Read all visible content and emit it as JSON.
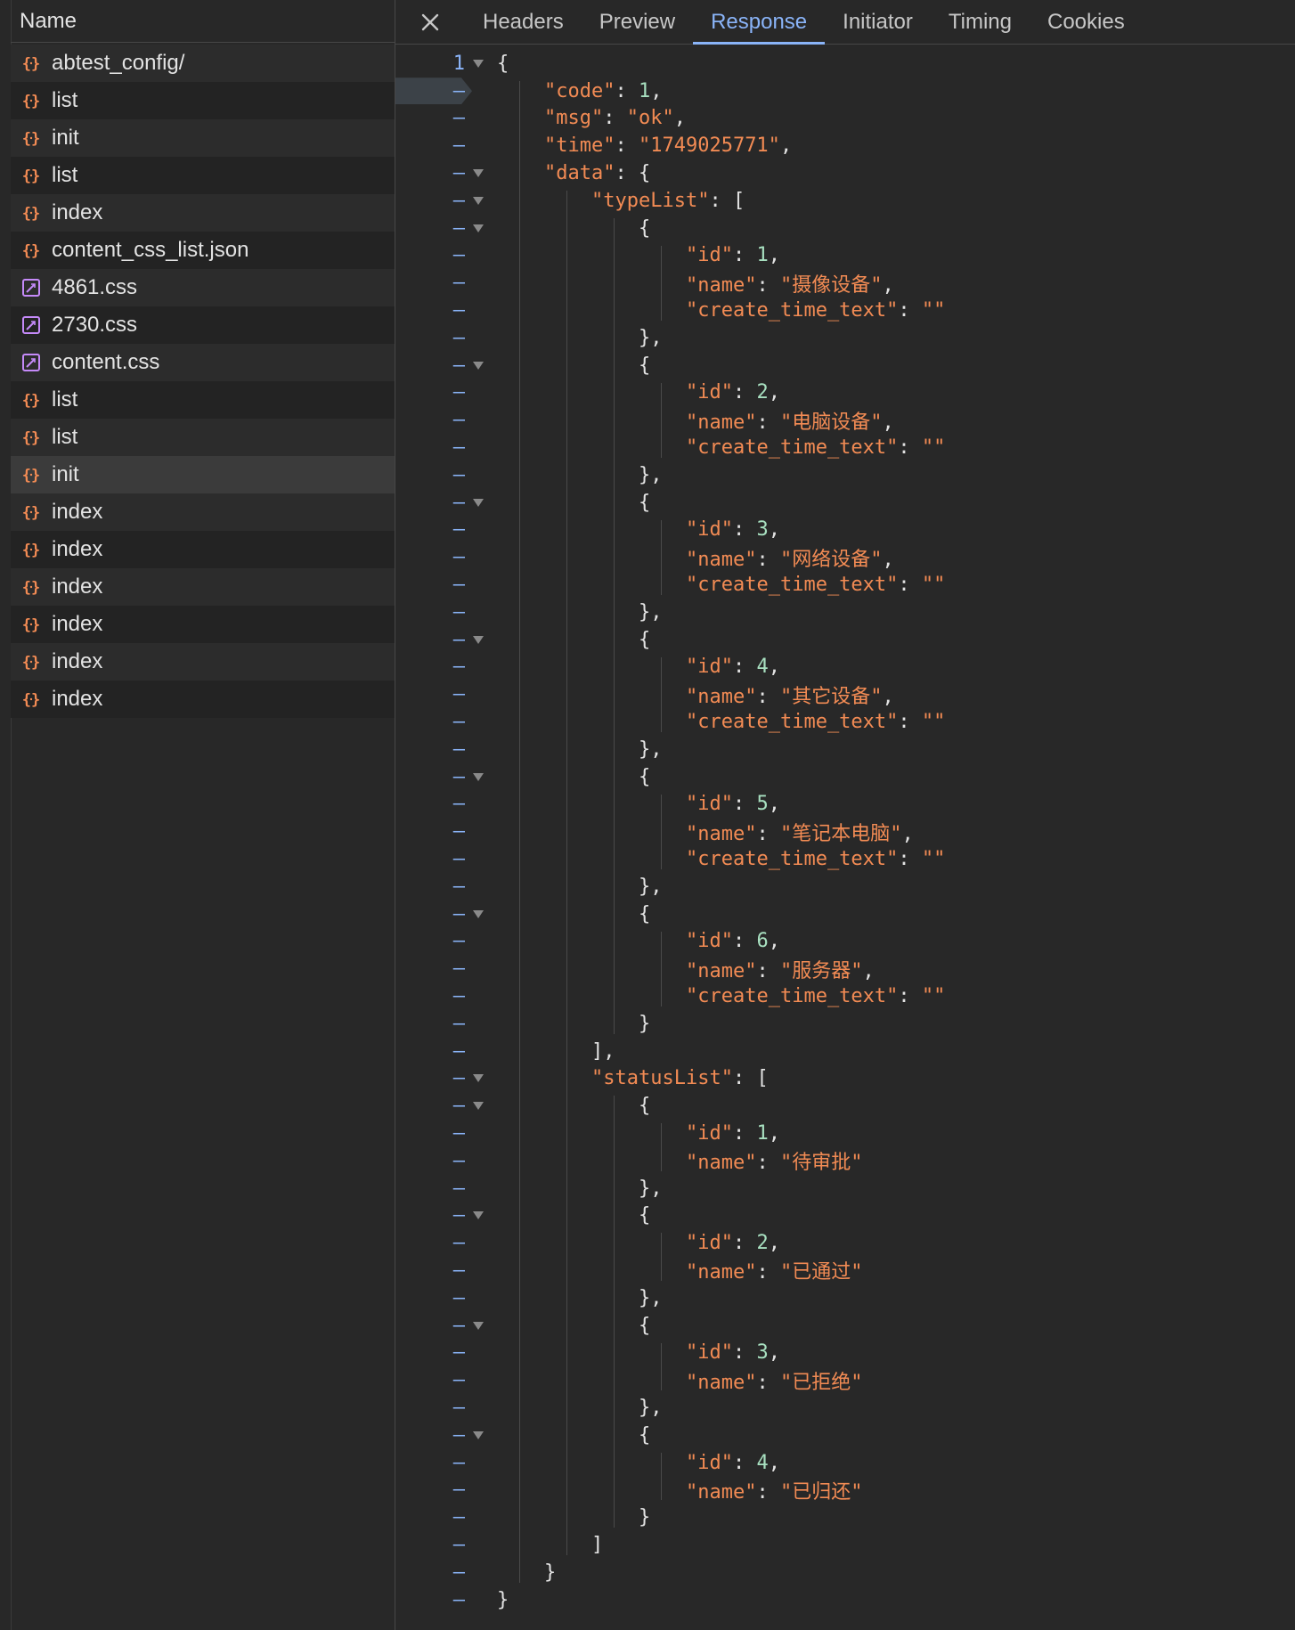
{
  "left_panel": {
    "header": "Name",
    "requests": [
      {
        "label": "abtest_config/",
        "type": "json"
      },
      {
        "label": "list",
        "type": "json"
      },
      {
        "label": "init",
        "type": "json"
      },
      {
        "label": "list",
        "type": "json"
      },
      {
        "label": "index",
        "type": "json"
      },
      {
        "label": "content_css_list.json",
        "type": "json"
      },
      {
        "label": "4861.css",
        "type": "css"
      },
      {
        "label": "2730.css",
        "type": "css"
      },
      {
        "label": "content.css",
        "type": "css"
      },
      {
        "label": "list",
        "type": "json"
      },
      {
        "label": "list",
        "type": "json"
      },
      {
        "label": "init",
        "type": "json",
        "selected": true
      },
      {
        "label": "index",
        "type": "json"
      },
      {
        "label": "index",
        "type": "json"
      },
      {
        "label": "index",
        "type": "json"
      },
      {
        "label": "index",
        "type": "json"
      },
      {
        "label": "index",
        "type": "json"
      },
      {
        "label": "index",
        "type": "json"
      }
    ]
  },
  "tabs": {
    "close_icon": "close-icon",
    "items": [
      "Headers",
      "Preview",
      "Response",
      "Initiator",
      "Timing",
      "Cookies"
    ],
    "active": "Response"
  },
  "response": {
    "first_line_number": "1",
    "other_line_marker": "–",
    "code": 1,
    "msg": "ok",
    "time": "1749025771",
    "typeList": [
      {
        "id": 1,
        "name": "摄像设备",
        "create_time_text": ""
      },
      {
        "id": 2,
        "name": "电脑设备",
        "create_time_text": ""
      },
      {
        "id": 3,
        "name": "网络设备",
        "create_time_text": ""
      },
      {
        "id": 4,
        "name": "其它设备",
        "create_time_text": ""
      },
      {
        "id": 5,
        "name": "笔记本电脑",
        "create_time_text": ""
      },
      {
        "id": 6,
        "name": "服务器",
        "create_time_text": ""
      }
    ],
    "statusList": [
      {
        "id": 1,
        "name": "待审批"
      },
      {
        "id": 2,
        "name": "已通过"
      },
      {
        "id": 3,
        "name": "已拒绝"
      },
      {
        "id": 4,
        "name": "已归还"
      }
    ]
  },
  "colors": {
    "accent": "#8ab4f8",
    "json_icon": "#f28b54",
    "css_icon": "#c58af9",
    "key_string": "#f28b54",
    "number": "#a8e0c0"
  }
}
